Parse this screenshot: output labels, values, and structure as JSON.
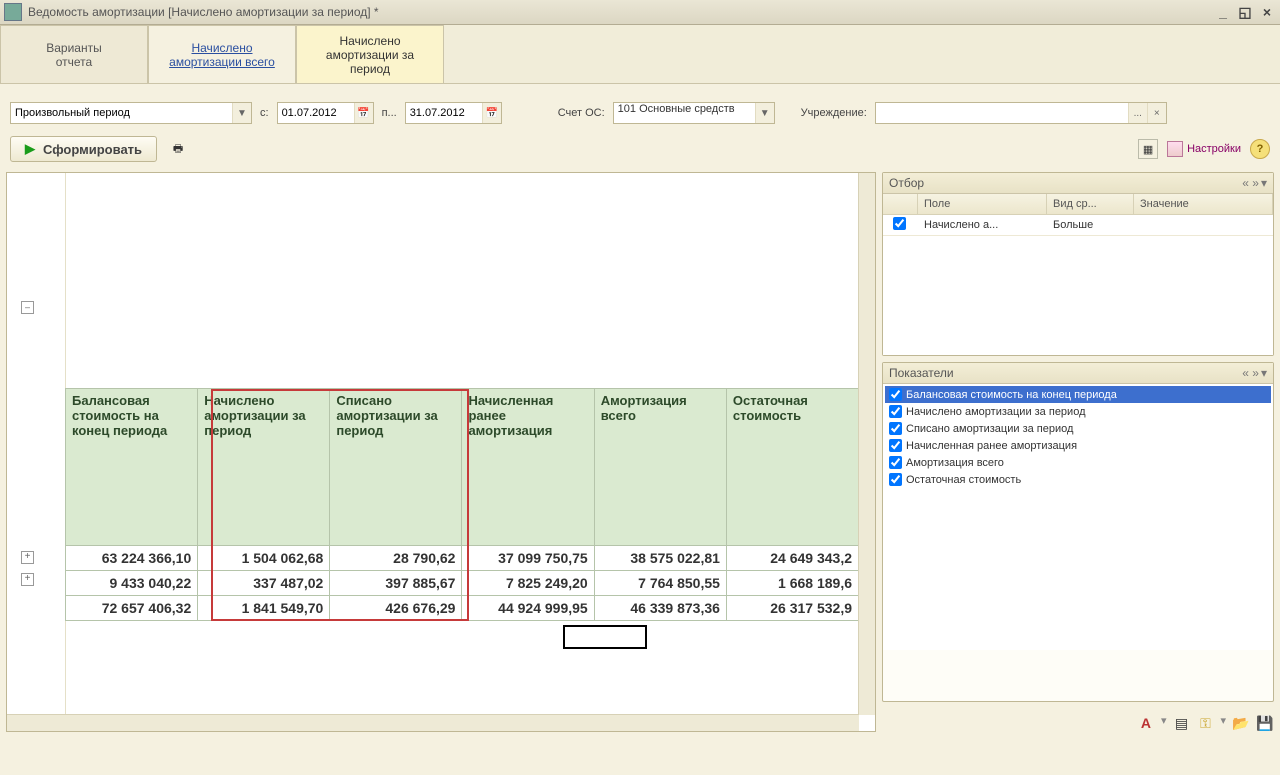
{
  "window": {
    "title": "Ведомость амортизации [Начислено амортизации за период] *"
  },
  "tabs": {
    "variants": "Варианты\nотчета",
    "link": "Начислено\nамортизации всего",
    "active": "Начислено\nамортизации за\nпериод"
  },
  "filter": {
    "period_combo": "Произвольный период",
    "from_lbl": "с:",
    "from_date": "01.07.2012",
    "to_lbl": "п...",
    "to_date": "31.07.2012",
    "account_lbl": "Счет ОС:",
    "account_val": "101 Основные средств",
    "org_lbl": "Учреждение:",
    "org_val": ""
  },
  "actions": {
    "run": "Сформировать",
    "settings": "Настройки"
  },
  "table": {
    "headers": [
      "Балансовая стоимость на конец периода",
      "Начислено амортизации за период",
      "Списано амортизации за период",
      "Начисленная ранее амортизация",
      "Амортизация всего",
      "Остаточная стоимость"
    ],
    "rows": [
      [
        "63 224 366,10",
        "1 504 062,68",
        "28 790,62",
        "37 099 750,75",
        "38 575 022,81",
        "24 649 343,2"
      ],
      [
        "9 433 040,22",
        "337 487,02",
        "397 885,67",
        "7 825 249,20",
        "7 764 850,55",
        "1 668 189,6"
      ],
      [
        "72 657 406,32",
        "1 841 549,70",
        "426 676,29",
        "44 924 999,95",
        "46 339 873,36",
        "26 317 532,9"
      ]
    ]
  },
  "otbor": {
    "title": "Отбор",
    "cols": [
      "",
      "Поле",
      "Вид ср...",
      "Значение"
    ],
    "row": {
      "checked": true,
      "field": "Начислено а...",
      "cmp": "Больше",
      "val": ""
    }
  },
  "indicators": {
    "title": "Показатели",
    "items": [
      {
        "checked": true,
        "label": "Балансовая стоимость на конец периода",
        "sel": true
      },
      {
        "checked": true,
        "label": "Начислено амортизации за период"
      },
      {
        "checked": true,
        "label": "Списано амортизации за период"
      },
      {
        "checked": true,
        "label": "Начисленная ранее амортизация"
      },
      {
        "checked": true,
        "label": "Амортизация всего"
      },
      {
        "checked": true,
        "label": "Остаточная стоимость"
      }
    ]
  }
}
